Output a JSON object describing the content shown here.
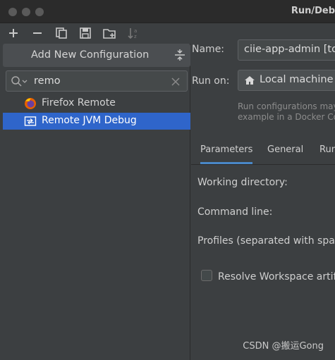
{
  "window": {
    "title": "Run/Deb"
  },
  "toolbar": {
    "icons": [
      "add-icon",
      "remove-icon",
      "copy-icon",
      "save-icon",
      "new-folder-icon",
      "sort-icon"
    ]
  },
  "left_panel": {
    "add_new_label": "Add New Configuration",
    "search": {
      "value": "remo"
    },
    "items": [
      {
        "label": "Firefox Remote",
        "icon": "firefox-icon",
        "selected": false
      },
      {
        "label": "Remote JVM Debug",
        "icon": "remote-debug-icon",
        "selected": true
      }
    ]
  },
  "right_panel": {
    "name_label": "Name:",
    "name_value": "ciie-app-admin [to",
    "run_on_label": "Run on:",
    "run_on_value": "Local machine",
    "hint_line1": "Run configurations may",
    "hint_line2": "example in a Docker Co",
    "tabs": [
      "Parameters",
      "General",
      "Run"
    ],
    "active_tab": "Parameters",
    "fields": {
      "working_dir": "Working directory:",
      "command_line": "Command line:",
      "profiles": "Profiles (separated with spac",
      "resolve": "Resolve Workspace artifa"
    }
  },
  "watermark": "CSDN @搬运Gong",
  "colors": {
    "accent": "#2f65ca",
    "tab_underline": "#4a88c7",
    "background": "#3c3f41"
  }
}
